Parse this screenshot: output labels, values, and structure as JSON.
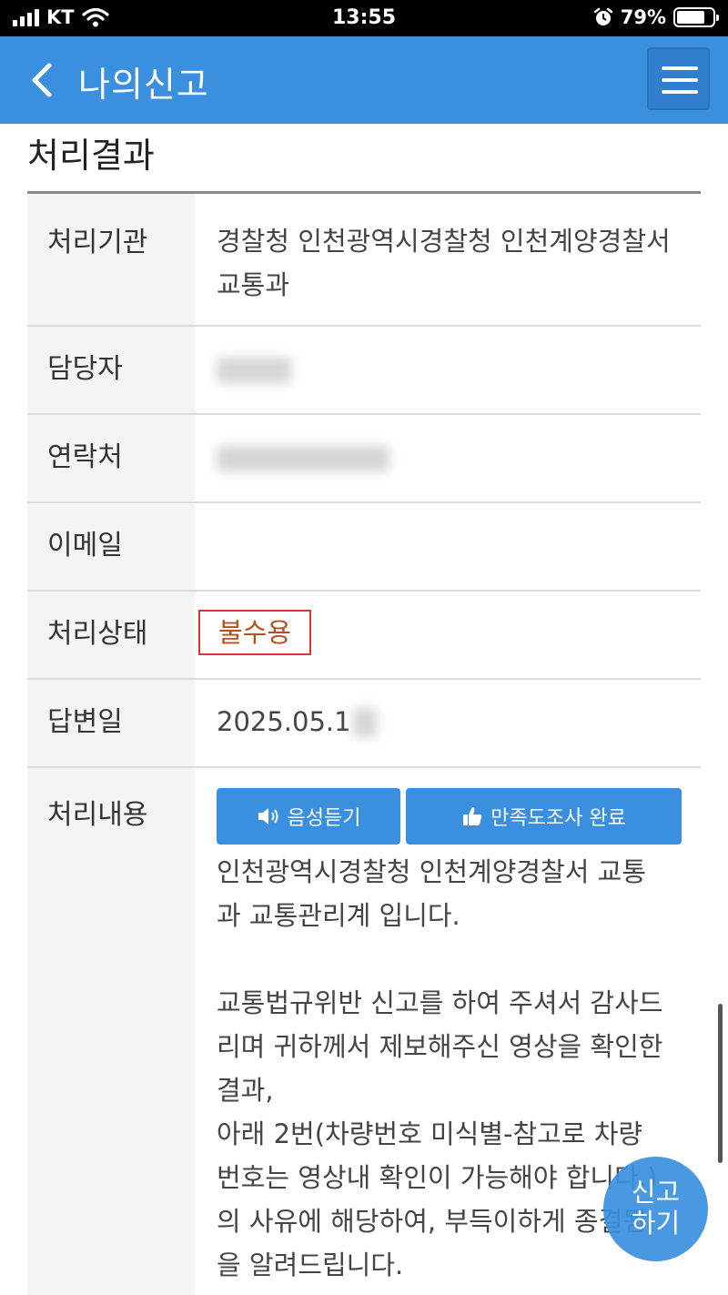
{
  "status_bar": {
    "carrier": "KT",
    "time": "13:55",
    "battery_percent": "79%",
    "battery_level": 0.79
  },
  "header": {
    "title": "나의신고"
  },
  "section": {
    "title": "처리결과"
  },
  "details": {
    "agency_label": "처리기관",
    "agency_value": "경찰청 인천광역시경찰청 인천계양경찰서 교통과",
    "manager_label": "담당자",
    "contact_label": "연락처",
    "email_label": "이메일",
    "email_value": "",
    "status_label": "처리상태",
    "status_value": "불수용",
    "answer_date_label": "답변일",
    "answer_date_value": "2025.05.1",
    "content_label": "처리내용"
  },
  "buttons": {
    "voice": "음성듣기",
    "survey": "만족도조사 완료"
  },
  "content": {
    "text": "인천광역시경찰청 인천계양경찰서 교통\n과 교통관리계 입니다.\n\n교통법규위반 신고를 하여 주셔서 감사드\n리며 귀하께서 제보해주신 영상을 확인한\n결과,\n아래 2번(차량번호 미식별-참고로 차량\n번호는 영상내 확인이 가능해야 합니다.)\n의 사유에 해당하여, 부득이하게 종결됨\n을 알려드립니다."
  },
  "fab": {
    "line1": "신고",
    "line2": "하기"
  },
  "colors": {
    "header_bg": "#3a8fdf",
    "status_text": "#b5511d",
    "status_border": "#dd3333"
  }
}
